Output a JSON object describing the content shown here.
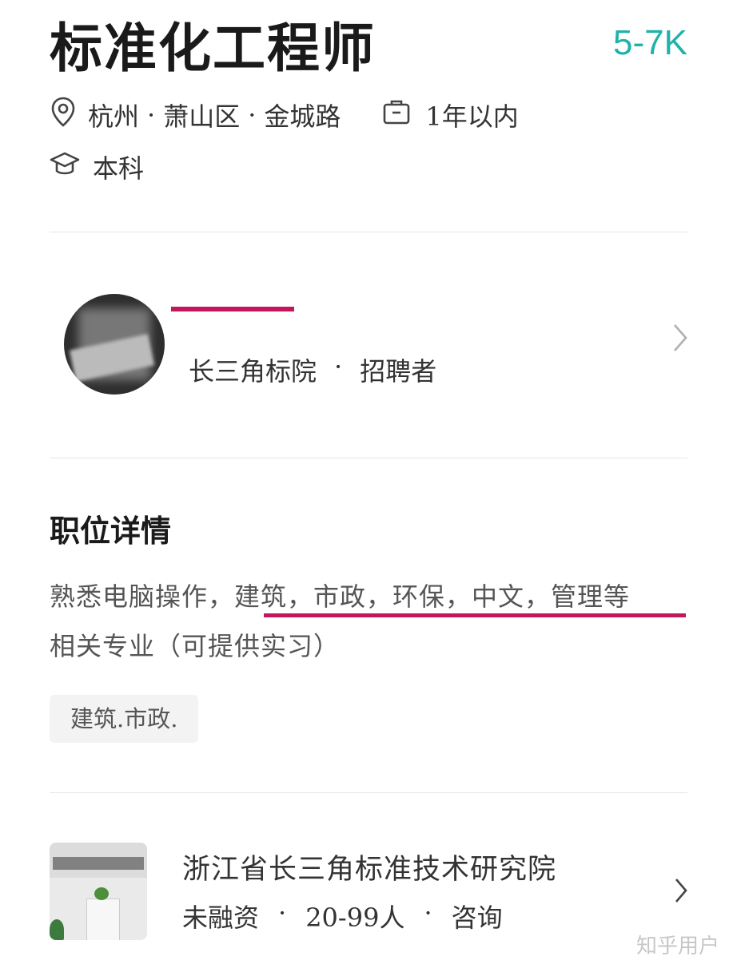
{
  "job": {
    "title": "标准化工程师",
    "salary": "5-7K",
    "location": {
      "city": "杭州",
      "district": "萧山区",
      "street": "金城路",
      "separator": "·"
    },
    "experience": "1年以内",
    "education": "本科"
  },
  "recruiter": {
    "company": "长三角标院",
    "role": "招聘者",
    "separator": "·"
  },
  "details": {
    "section_title": "职位详情",
    "description_line1": "熟悉电脑操作，建筑，市政，环保，中文，管理等",
    "description_line2": "相关专业（可提供实习）",
    "tag": "建筑.市政."
  },
  "company": {
    "name": "浙江省长三角标准技术研究院",
    "funding": "未融资",
    "size": "20-99人",
    "industry": "咨询",
    "separator": "·"
  },
  "watermark": "知乎用户",
  "colors": {
    "salary": "#20b2aa",
    "annotation": "#c2185b"
  },
  "icons": [
    "location-icon",
    "briefcase-icon",
    "education-icon",
    "chevron-right-icon"
  ]
}
